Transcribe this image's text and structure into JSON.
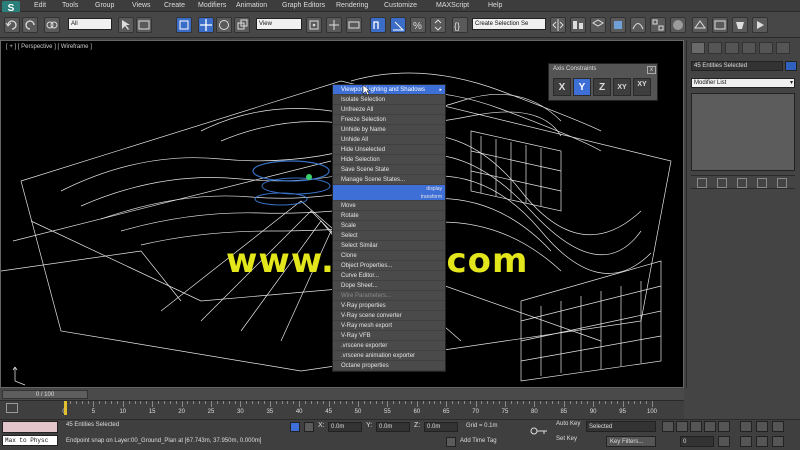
{
  "menubar": {
    "logo": "S",
    "items": [
      "Edit",
      "Tools",
      "Group",
      "Views",
      "Create",
      "Modifiers",
      "Animation",
      "Graph Editors",
      "Rendering",
      "Customize",
      "MAXScript",
      "Help"
    ]
  },
  "toolbar": {
    "filter_value": "All",
    "refcoord_value": "View",
    "named_selection_value": "Create Selection Se"
  },
  "viewport": {
    "label": "[ + ] [ Perspective ] [ Wireframe ]",
    "watermark": "www.cgtsj.com"
  },
  "context_menu": {
    "items": [
      {
        "label": "Viewport Lighting and Shadows",
        "state": "highlight",
        "arrow": "▸"
      },
      {
        "label": "Isolate Selection",
        "state": "normal"
      },
      {
        "label": "Unfreeze All",
        "state": "normal"
      },
      {
        "label": "Freeze Selection",
        "state": "normal"
      },
      {
        "label": "Unhide by Name",
        "state": "normal"
      },
      {
        "label": "Unhide All",
        "state": "normal"
      },
      {
        "label": "Hide Unselected",
        "state": "normal"
      },
      {
        "label": "Hide Selection",
        "state": "normal"
      },
      {
        "label": "Save Scene State",
        "state": "normal"
      },
      {
        "label": "Manage Scene States...",
        "state": "normal"
      },
      {
        "label": "display",
        "state": "header",
        "right": "display"
      },
      {
        "label": "transform",
        "state": "header",
        "right": "transform"
      },
      {
        "label": "Move",
        "state": "normal"
      },
      {
        "label": "Rotate",
        "state": "normal"
      },
      {
        "label": "Scale",
        "state": "normal"
      },
      {
        "label": "Select",
        "state": "normal"
      },
      {
        "label": "Select Similar",
        "state": "normal"
      },
      {
        "label": "Clone",
        "state": "normal"
      },
      {
        "label": "Object Properties...",
        "state": "normal"
      },
      {
        "label": "Curve Editor...",
        "state": "normal"
      },
      {
        "label": "Dope Sheet...",
        "state": "normal"
      },
      {
        "label": "Wire Parameters...",
        "state": "disabled"
      },
      {
        "label": "V-Ray properties",
        "state": "normal"
      },
      {
        "label": "V-Ray scene converter",
        "state": "normal"
      },
      {
        "label": "V-Ray mesh export",
        "state": "normal"
      },
      {
        "label": "V-Ray VFB",
        "state": "normal"
      },
      {
        "label": ".vrscene exporter",
        "state": "normal"
      },
      {
        "label": ".vrscene animation exporter",
        "state": "normal"
      },
      {
        "label": "Octane properties",
        "state": "normal"
      }
    ]
  },
  "axis_constraints": {
    "title": "Axis Constraints",
    "close": "x",
    "buttons": [
      {
        "label": "X",
        "active": false
      },
      {
        "label": "Y",
        "active": true
      },
      {
        "label": "Z",
        "active": false
      },
      {
        "label": "XY",
        "active": false
      },
      {
        "label": "XY",
        "active": false
      }
    ]
  },
  "command_panel": {
    "selection": "45 Entities Selected",
    "modifier_list": "Modifier List",
    "modifier_list_arrow": "▾"
  },
  "timeline": {
    "slider_text": "0 / 100",
    "ticks": [
      0,
      5,
      10,
      15,
      20,
      25,
      30,
      35,
      40,
      45,
      50,
      55,
      60,
      65,
      70,
      75,
      80,
      85,
      90,
      95,
      100
    ]
  },
  "status": {
    "maxscript_output": "Max to Physc",
    "selection_status": "45 Entities Selected",
    "prompt": "Endpoint snap on Layer:00_Ground_Plan at [67.743m, 37.950m, 0.000m]",
    "x_label": "X:",
    "x_value": "0.0m",
    "y_label": "Y:",
    "y_value": "0.0m",
    "z_label": "Z:",
    "z_value": "0.0m",
    "grid": "Grid = 0.1m",
    "add_time_tag": "Add Time Tag",
    "auto_key": "Auto Key",
    "set_key": "Set Key",
    "key_mode": "Selected",
    "key_filters": "Key Filters...",
    "frame": "0"
  },
  "colors": {
    "accent": "#3d6fd6",
    "watermark": "#e3e61a",
    "wire": "#ffffff"
  }
}
